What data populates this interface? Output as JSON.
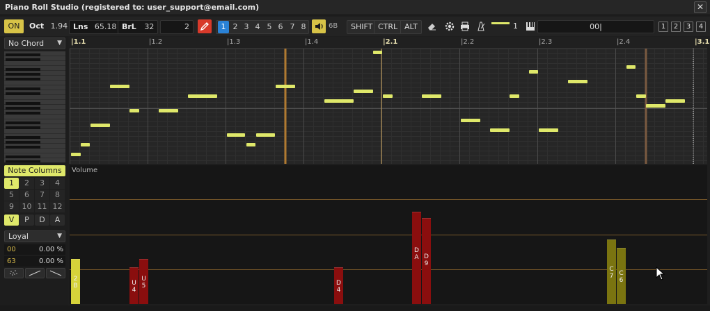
{
  "window": {
    "title": "Piano Roll Studio  (registered to: user_support@email.com)",
    "close_glyph": "✕"
  },
  "toolbar": {
    "on_label": "ON",
    "oct_label": "Oct",
    "oct_value": "1.94",
    "lns_label": "Lns",
    "lns_value": "65.18",
    "brl_label": "BrL",
    "brl_value": "32",
    "step_value": "2",
    "pattern_numbers": [
      "1",
      "2",
      "3",
      "4",
      "5",
      "6",
      "7",
      "8"
    ],
    "active_pattern": "1",
    "volume_value": "6B",
    "modifiers": [
      "SHIFT",
      "CTRL",
      "ALT"
    ],
    "track_value": "1",
    "text_input_value": "00|",
    "view_buttons": [
      "1",
      "2",
      "3",
      "4"
    ],
    "accent_color": "#dfe86a",
    "on_color": "#d7c347",
    "active_blue": "#2a82d6",
    "record_red": "#d83a2b"
  },
  "left": {
    "chord_select": "No Chord",
    "note_columns_label": "Note Columns",
    "note_columns": [
      "1",
      "2",
      "3",
      "4",
      "5",
      "6",
      "7",
      "8",
      "9",
      "10",
      "11",
      "12"
    ],
    "active_column": "1",
    "param_buttons": [
      "V",
      "P",
      "D",
      "A"
    ],
    "active_param": "V",
    "mode_select": "Loyal",
    "rows": [
      {
        "key": "00",
        "value": "0.00 %"
      },
      {
        "key": "63",
        "value": "0.00 %"
      }
    ]
  },
  "ruler": {
    "marks": [
      "1.1",
      "1.2",
      "1.3",
      "1.4",
      "2.1",
      "2.2",
      "2.3",
      "2.4",
      "3.1"
    ]
  },
  "volume": {
    "title": "Volume",
    "bars": [
      {
        "label": "2B",
        "value": 0.42,
        "color": "#d6d23a"
      },
      {
        "label": "U4",
        "value": 0.34,
        "color": "#8a0e0e"
      },
      {
        "label": "U5",
        "value": 0.42,
        "color": "#8a0e0e"
      },
      {
        "label": "D4",
        "value": 0.34,
        "color": "#8a0e0e"
      },
      {
        "label": "DA",
        "value": 0.86,
        "color": "#8a0e0e"
      },
      {
        "label": "D9",
        "value": 0.8,
        "color": "#8a0e0e"
      },
      {
        "label": "C7",
        "value": 0.6,
        "color": "#7a7410"
      },
      {
        "label": "C6",
        "value": 0.52,
        "color": "#7a7410"
      }
    ]
  }
}
